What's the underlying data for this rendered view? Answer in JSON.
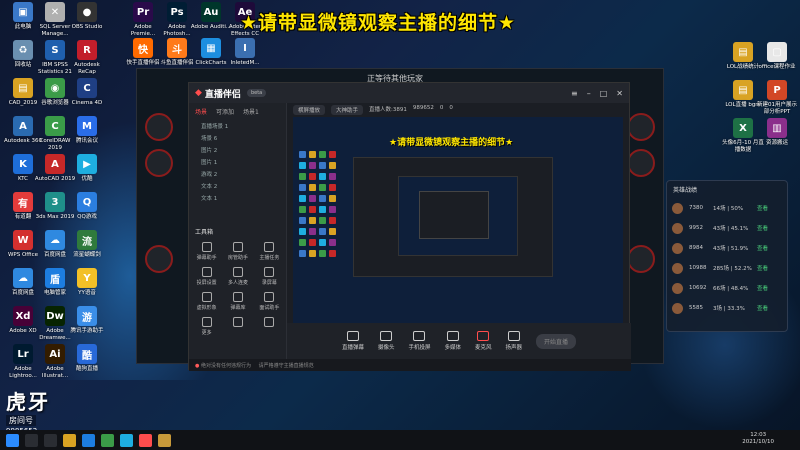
{
  "banner": "★请带显微镜观察主播的细节★",
  "desktop_icons_left": [
    {
      "label": "此电脑",
      "color": "#3a78c8",
      "glyph": "▣",
      "icon": "computer-icon"
    },
    {
      "label": "SQL Server Manage...",
      "color": "#b0b0b0",
      "glyph": "✕",
      "icon": "sql-icon"
    },
    {
      "label": "OBS Studio",
      "color": "#333",
      "glyph": "●",
      "icon": "obs-icon"
    },
    {
      "label": "回收站",
      "color": "#6a8fb0",
      "glyph": "♻",
      "icon": "recycle-bin-icon"
    },
    {
      "label": "IBM SPSS Statistics 21",
      "color": "#1f5fae",
      "glyph": "S",
      "icon": "spss-icon"
    },
    {
      "label": "Autodesk ReCap",
      "color": "#c21e2b",
      "glyph": "R",
      "icon": "recap-icon"
    },
    {
      "label": "CAD_2019",
      "color": "#d9a323",
      "glyph": "▤",
      "icon": "folder-icon"
    },
    {
      "label": "谷歌浏览器",
      "color": "#3b9c48",
      "glyph": "◉",
      "icon": "chrome-icon"
    },
    {
      "label": "Cinema 4D",
      "color": "#1f3f84",
      "glyph": "C",
      "icon": "cinema4d-icon"
    },
    {
      "label": "Autodesk 360",
      "color": "#2a6bb1",
      "glyph": "A",
      "icon": "autodesk-icon"
    },
    {
      "label": "CorelDRAW 2019",
      "color": "#3a9c48",
      "glyph": "C",
      "icon": "coreldraw-icon"
    },
    {
      "label": "腾讯会议",
      "color": "#2a6de8",
      "glyph": "M",
      "icon": "meeting-icon"
    },
    {
      "label": "KTC",
      "color": "#1e6ed9",
      "glyph": "K",
      "icon": "ktc-icon"
    },
    {
      "label": "AutoCAD 2019",
      "color": "#c62828",
      "glyph": "A",
      "icon": "autocad-icon"
    },
    {
      "label": "优酷",
      "color": "#1eaee0",
      "glyph": "▶",
      "icon": "youku-icon"
    },
    {
      "label": "有道翻",
      "color": "#e33b3b",
      "glyph": "有",
      "icon": "youdao-icon"
    },
    {
      "label": "3ds Max 2019",
      "color": "#1f8f8a",
      "glyph": "3",
      "icon": "3dsmax-icon"
    },
    {
      "label": "QQ游戏",
      "color": "#2b7ee0",
      "glyph": "Q",
      "icon": "qqgame-icon"
    },
    {
      "label": "WPS Office",
      "color": "#d3302f",
      "glyph": "W",
      "icon": "wps-icon"
    },
    {
      "label": "百度网盘",
      "color": "#2f89e0",
      "glyph": "☁",
      "icon": "baidu-netdisk-icon"
    },
    {
      "label": "流星蝴蝶剑",
      "color": "#2f7a3c",
      "glyph": "流",
      "icon": "game-icon"
    },
    {
      "label": "百度网盘",
      "color": "#2f89e0",
      "glyph": "☁",
      "icon": "baidu-netdisk-icon"
    },
    {
      "label": "电脑管家",
      "color": "#1d7de0",
      "glyph": "盾",
      "icon": "security-icon"
    },
    {
      "label": "YY语音",
      "color": "#f2c027",
      "glyph": "Y",
      "icon": "yy-icon"
    },
    {
      "label": "Adobe XD",
      "color": "#470137",
      "glyph": "Xd",
      "icon": "adobe-xd-icon"
    },
    {
      "label": "Adobe Dreamwe...",
      "color": "#072401",
      "glyph": "Dw",
      "icon": "dreamweaver-icon"
    },
    {
      "label": "腾讯手游助手",
      "color": "#3a8ee8",
      "glyph": "游",
      "icon": "tencent-game-icon"
    },
    {
      "label": "Adobe Lightroo...",
      "color": "#001a30",
      "glyph": "Lr",
      "icon": "lightroom-icon"
    },
    {
      "label": "Adobe Illustrat...",
      "color": "#331c00",
      "glyph": "Ai",
      "icon": "illustrator-icon"
    },
    {
      "label": "酷狗直播",
      "color": "#2869d8",
      "glyph": "酷",
      "icon": "kugou-icon"
    }
  ],
  "desktop_icons_top": [
    {
      "label": "Adobe Premie...",
      "color": "#2a0a4a",
      "glyph": "Pr",
      "icon": "premiere-icon"
    },
    {
      "label": "Adobe Photosh...",
      "color": "#001d34",
      "glyph": "Ps",
      "icon": "photoshop-icon"
    },
    {
      "label": "Adobe Auditi...",
      "color": "#00362b",
      "glyph": "Au",
      "icon": "audition-icon"
    },
    {
      "label": "Adobe After Effects CC",
      "color": "#1e0a3a",
      "glyph": "Ae",
      "icon": "after-effects-icon"
    },
    {
      "label": "快手直播伴侣",
      "color": "#ff6a00",
      "glyph": "快",
      "icon": "kuaishou-icon"
    },
    {
      "label": "斗鱼直播伴侣",
      "color": "#ff7a1a",
      "glyph": "斗",
      "icon": "douyu-icon"
    },
    {
      "label": "ClickCharts",
      "color": "#1d8ee0",
      "glyph": "▦",
      "icon": "clickcharts-icon"
    },
    {
      "label": "InletedM...",
      "color": "#3b6fb0",
      "glyph": "I",
      "icon": "app-icon"
    }
  ],
  "desktop_icons_right": [
    {
      "label": "LOL战绩统计",
      "color": "#d9a323",
      "glyph": "▤",
      "icon": "folder-icon"
    },
    {
      "label": "office课程作业",
      "color": "#e8e8e8",
      "glyph": "▢",
      "icon": "document-icon"
    },
    {
      "label": "LOL直播 bgm",
      "color": "#d9a323",
      "glyph": "▤",
      "icon": "folder-icon"
    },
    {
      "label": "新建01用户展示部分析PPT",
      "color": "#d24726",
      "glyph": "P",
      "icon": "ppt-icon"
    },
    {
      "label": "头像6月-10 月直播数据",
      "color": "#1e7145",
      "glyph": "X",
      "icon": "excel-icon"
    },
    {
      "label": "资源搬运",
      "color": "#8b2f8b",
      "glyph": "▥",
      "icon": "archive-icon"
    }
  ],
  "game_window_title": "正等待其他玩家",
  "app": {
    "name": "直播伴侣",
    "version": "beta",
    "left_tabs": [
      "场景",
      "可添加",
      "场景1"
    ],
    "scenes": [
      "直播场景 1",
      "场景 6",
      "图片 2",
      "图片 1",
      "游戏 2",
      "文本 2",
      "文本 1"
    ],
    "toolbox_title": "工具箱",
    "tools": [
      "弹幕助手",
      "房管助手",
      "主播任务",
      "投屏设置",
      "多人连麦",
      "录屏幕",
      "虚拟形象",
      "弹幕库",
      "面试助手",
      "更多",
      "",
      ""
    ],
    "preview_tabs": [
      "横屏播放",
      "大神助手"
    ],
    "preview_stats": [
      "直播人数:3891",
      "989652",
      "0",
      "0"
    ],
    "preview_banner": "★请带显微镜观察主播的细节★",
    "bottom_tools": [
      "直播弹幕",
      "摄像头",
      "手机投屏",
      "多媒体",
      "麦克风",
      "扬声器"
    ],
    "go_live": "开始直播",
    "status_text": "绝对没有任何违规行为",
    "status_warning": "请严格遵守主播直播规范"
  },
  "ladder": {
    "title": "英雄战绩",
    "rows": [
      {
        "n": "7380",
        "r": "14场 | 50%",
        "a": "查看"
      },
      {
        "n": "9952",
        "r": "43场 | 45.1%",
        "a": "查看"
      },
      {
        "n": "8984",
        "r": "43场 | 51.9%",
        "a": "查看"
      },
      {
        "n": "10988",
        "r": "285场 | 52.2%",
        "a": "查看"
      },
      {
        "n": "10692",
        "r": "66场 | 48.4%",
        "a": "查看"
      },
      {
        "n": "5585",
        "r": "3场 | 33.3%",
        "a": "查看"
      }
    ]
  },
  "watermark": {
    "logo": "虎牙",
    "sub": "房间号",
    "room": "9985652"
  },
  "clock": {
    "time": "12:03",
    "date": "2021/10/10"
  }
}
